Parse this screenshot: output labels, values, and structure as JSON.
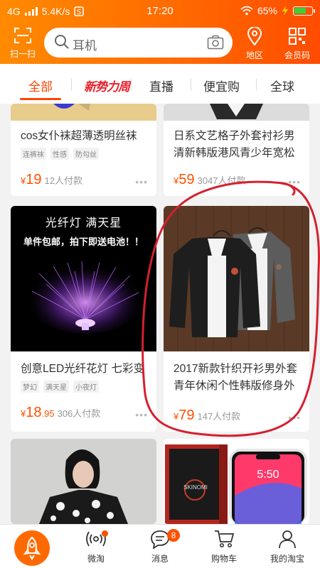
{
  "status_bar": {
    "network": "4G",
    "speed": "5.4K/s",
    "time": "17:20",
    "battery": "65%"
  },
  "header": {
    "scan_label": "扫一扫",
    "search_placeholder": "耳机",
    "location_label": "地区",
    "member_label": "会员码"
  },
  "tabs": [
    {
      "label": "全部",
      "active": true
    },
    {
      "label": "新势力周",
      "active": false
    },
    {
      "label": "直播",
      "active": false
    },
    {
      "label": "便宜购",
      "active": false
    },
    {
      "label": "全球",
      "active": false
    }
  ],
  "products": [
    {
      "title": "cos女仆袜超薄透明丝袜",
      "tags": [
        "连裤袜",
        "性感",
        "防勾丝"
      ],
      "price_int": "19",
      "price_dec": "",
      "paid": "12人付款"
    },
    {
      "title_line1": "日系文艺格子外套衬衫男",
      "title_line2": "清新韩版港风青少年宽松",
      "price_int": "59",
      "price_dec": "",
      "paid": "3047人付款"
    },
    {
      "image_text_top": "光纤灯 满天星",
      "image_text_sub": "单件包邮，拍下即送电池！！",
      "title": "创意LED光纤花灯 七彩变",
      "tags": [
        "梦幻",
        "满天星",
        "小夜灯"
      ],
      "price_int": "18",
      "price_dec": ".95",
      "paid": "306人付款"
    },
    {
      "title_line1": "2017新款针织开衫男外套",
      "title_line2": "青年休闲个性韩版修身外",
      "price_int": "79",
      "price_dec": "",
      "paid": "147人付款"
    },
    {
      "image_desc": "woman in patterned shirt"
    },
    {
      "image_brand": "SKINOMI",
      "phone_time": "5:50"
    }
  ],
  "currency_symbol": "¥",
  "more_glyph": "•••",
  "bottom_nav": {
    "items": [
      {
        "label": "微淘"
      },
      {
        "label": "消息",
        "badge": "8"
      },
      {
        "label": "购物车"
      },
      {
        "label": "我的淘宝"
      }
    ]
  },
  "colors": {
    "brand_orange": "#ff5000",
    "tab_active": "#ff4400",
    "annotation_red": "#d42030"
  }
}
